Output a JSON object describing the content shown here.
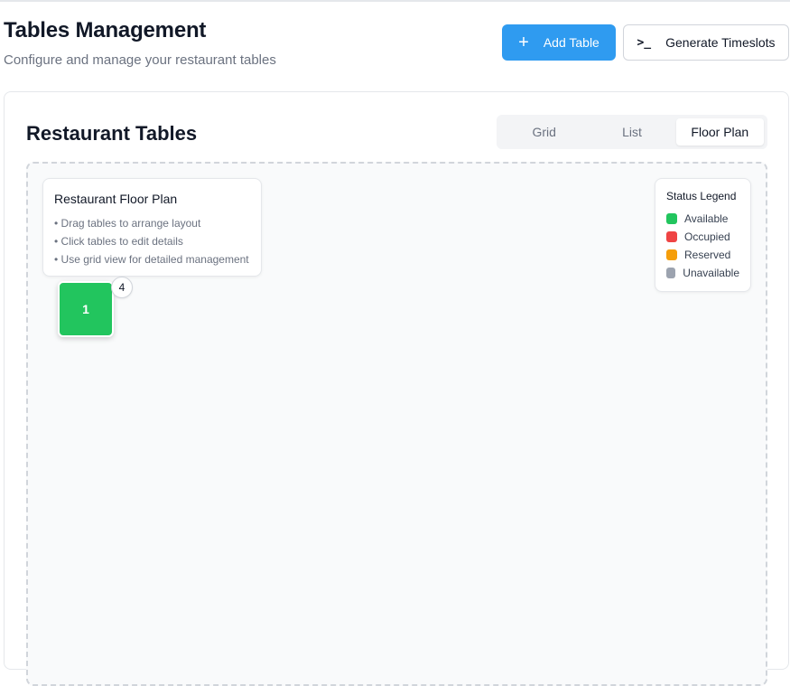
{
  "header": {
    "title": "Tables Management",
    "subtitle": "Configure and manage your restaurant tables",
    "add_button_label": "Add Table",
    "generate_button_label": "Generate Timeslots"
  },
  "card": {
    "title": "Restaurant Tables",
    "tabs": [
      {
        "label": "Grid",
        "active": false
      },
      {
        "label": "List",
        "active": false
      },
      {
        "label": "Floor Plan",
        "active": true
      }
    ]
  },
  "floor_plan": {
    "info": {
      "title": "Restaurant Floor Plan",
      "lines": [
        "• Drag tables to arrange layout",
        "• Click tables to edit details",
        "• Use grid view for detailed management"
      ]
    },
    "legend": {
      "title": "Status Legend",
      "items": [
        {
          "label": "Available",
          "color": "#22c55e"
        },
        {
          "label": "Occupied",
          "color": "#ef4444"
        },
        {
          "label": "Reserved",
          "color": "#f59e0b"
        },
        {
          "label": "Unavailable",
          "color": "#9ca3af"
        }
      ]
    },
    "tables": [
      {
        "number": "1",
        "seats": "4",
        "status": "Available",
        "color": "#22c55e"
      }
    ]
  }
}
